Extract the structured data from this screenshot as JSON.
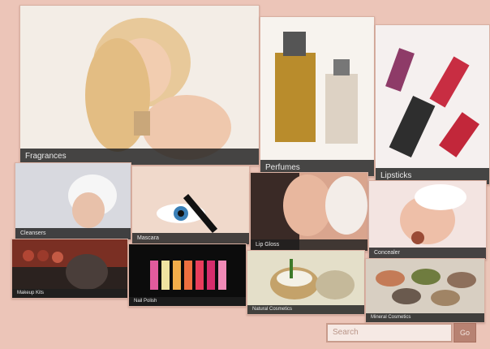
{
  "categories": {
    "fragrances": "Fragrances",
    "perfumes": "Perfumes",
    "lipsticks": "Lipsticks",
    "cleansers": "Cleansers",
    "mascara": "Mascara",
    "lip_gloss": "Lip Gloss",
    "concealer": "Concealer",
    "makeup_kits": "Makeup Kits",
    "nail_polish": "Nail Polish",
    "natural_cosmetics": "Natural Cosmetics",
    "mineral_cosmetics": "Mineral Cosmetics"
  },
  "search": {
    "placeholder": "Search",
    "button_label": "Go"
  }
}
